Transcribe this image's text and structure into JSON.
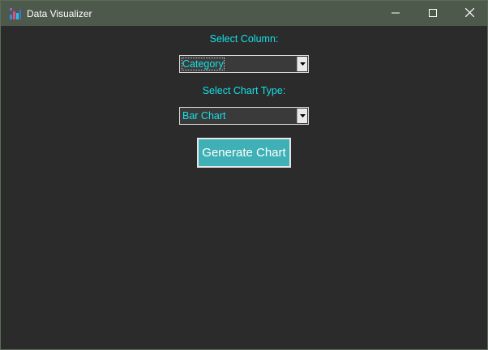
{
  "window": {
    "title": "Data Visualizer",
    "app_icon": "bar-chart-app-icon",
    "controls": {
      "minimize_icon": "minimize-icon",
      "maximize_icon": "maximize-icon",
      "close_icon": "close-icon"
    }
  },
  "form": {
    "column_label": "Select Column:",
    "column_value": "Category",
    "chart_type_label": "Select Chart Type:",
    "chart_type_value": "Bar Chart",
    "generate_button": "Generate Chart"
  },
  "colors": {
    "background": "#2b2b2b",
    "titlebar": "#4d5a4b",
    "label_text": "#14e2e8",
    "button_background": "#3fb0b6",
    "button_text": "#ffffff"
  }
}
